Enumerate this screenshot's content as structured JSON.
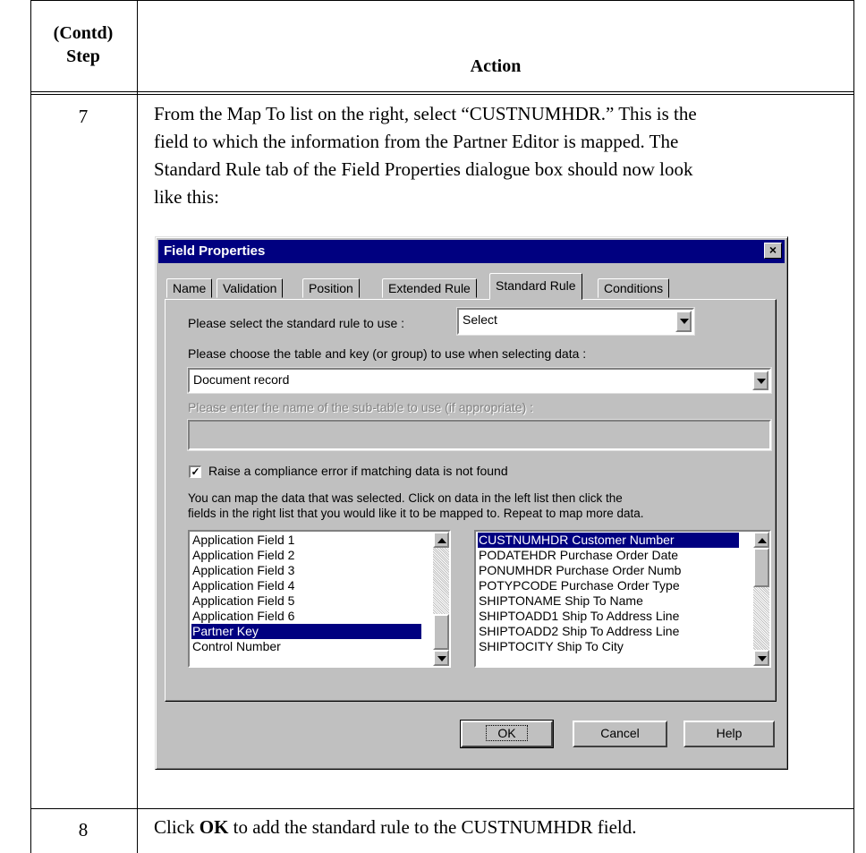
{
  "table": {
    "header_step": "(Contd)\nStep",
    "header_step_l1": "(Contd)",
    "header_step_l2": "Step",
    "header_action": "Action",
    "rows": [
      {
        "step": "7",
        "lines": [
          "From the Map To list on the right, select “CUSTNUMHDR.” This is the",
          "field to which the information from the Partner Editor is mapped. The",
          "Standard Rule tab of the Field Properties dialogue box should now look",
          "like this:"
        ]
      },
      {
        "step": "8",
        "pre": "Click ",
        "bold": "OK",
        "post": " to add the standard rule to the CUSTNUMHDR field."
      }
    ]
  },
  "dialog": {
    "title": "Field Properties",
    "close_glyph": "×",
    "tabs": [
      "Name",
      "Validation",
      "Position",
      "Extended Rule",
      "Standard Rule",
      "Conditions"
    ],
    "active_tab": "Standard Rule",
    "rule_label": "Please select the standard rule to use :",
    "rule_value": "Select",
    "table_label": "Please choose the table and key (or group) to use when selecting data :",
    "table_value": "Document record",
    "subtable_label": "Please enter the name of the sub-table to use (if appropriate) :",
    "subtable_value": "",
    "compliance_checked": true,
    "compliance_check_glyph": "✓",
    "compliance_label": "Raise a compliance error if matching data is not found",
    "instructions_1": "You can map the data that was selected. Click on data in the left list then click the",
    "instructions_2": "fields in the right list that you would like it to be mapped to. Repeat to map more data.",
    "left_list": [
      "Application Field 1",
      "Application Field 2",
      "Application Field 3",
      "Application Field 4",
      "Application Field 5",
      "Application Field 6",
      "Partner Key",
      "Control Number"
    ],
    "left_selected": "Partner Key",
    "right_list": [
      "CUSTNUMHDR Customer Number",
      "PODATEHDR Purchase Order Date",
      "PONUMHDR Purchase Order Numb",
      "POTYPCODE Purchase Order Type",
      "SHIPTONAME Ship To Name",
      "SHIPTOADD1 Ship To Address Line",
      "SHIPTOADD2 Ship To Address Line",
      "SHIPTOCITY Ship To City"
    ],
    "right_selected": "CUSTNUMHDR Customer Number",
    "ok_label": "OK",
    "cancel_label": "Cancel",
    "help_label": "Help"
  },
  "colors": {
    "dialog_face": "#c0c0c0",
    "titlebar": "#000080",
    "selection": "#000080"
  }
}
